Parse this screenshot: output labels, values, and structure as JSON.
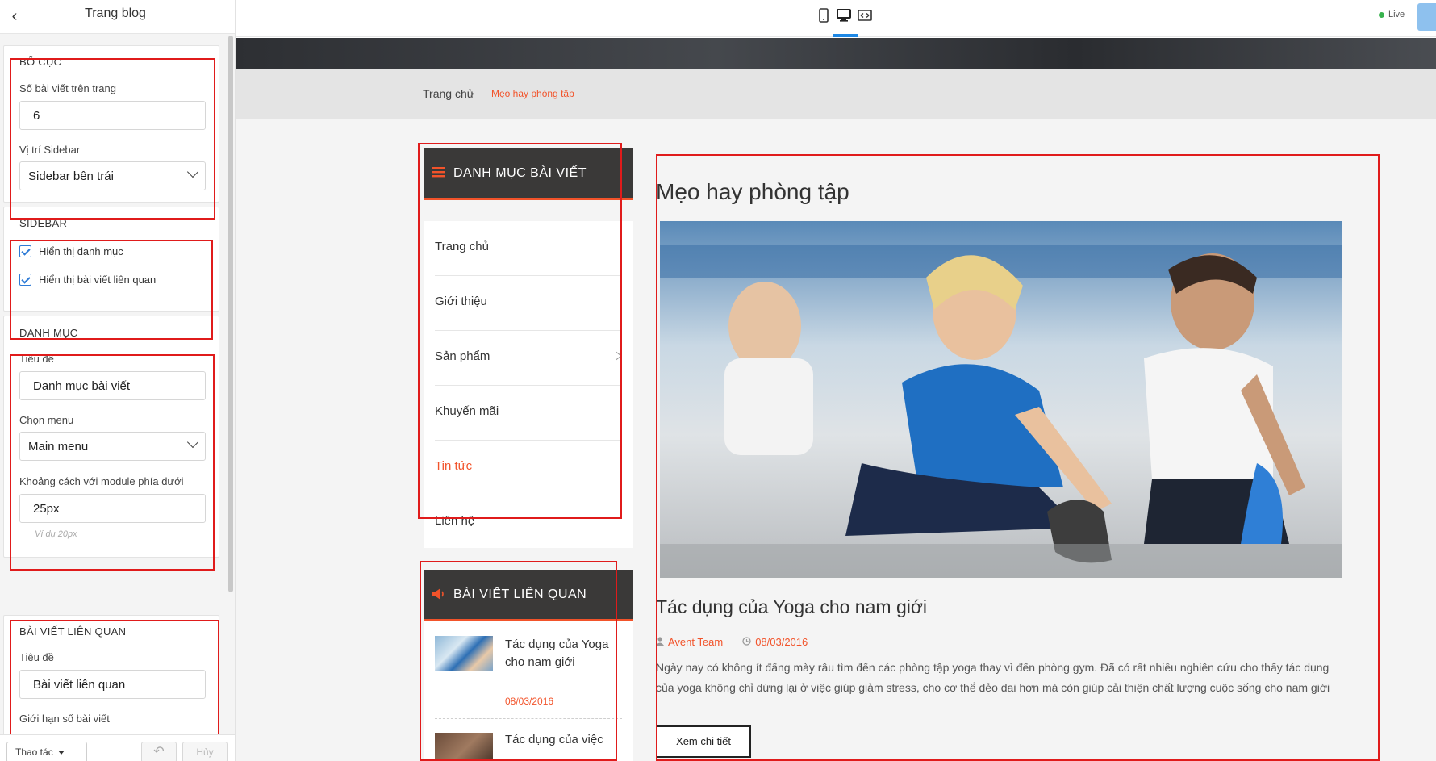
{
  "panel": {
    "title": "Trang blog",
    "layout": {
      "heading": "Bố cục",
      "posts_per_page_label": "Số bài viết trên trang",
      "posts_per_page_value": "6",
      "sidebar_position_label": "Vị trí Sidebar",
      "sidebar_position_value": "Sidebar bên trái"
    },
    "sidebar": {
      "heading": "SIDEBAR",
      "show_categories_label": "Hiển thị danh mục",
      "show_related_label": "Hiển thị bài viết liên quan"
    },
    "category": {
      "heading": "DANH MỤC",
      "title_label": "Tiêu đề",
      "title_value": "Danh mục bài viết",
      "menu_label": "Chọn menu",
      "menu_value": "Main menu",
      "spacing_label": "Khoảng cách với module phía dưới",
      "spacing_value": "25px",
      "spacing_hint": "Ví dụ 20px"
    },
    "related": {
      "heading": "BÀI VIẾT LIÊN QUAN",
      "title_label": "Tiêu đề",
      "title_value": "Bài viết liên quan",
      "limit_label": "Giới hạn số bài viết"
    },
    "footer": {
      "actions_label": "Thao tác",
      "undo_icon": "↶",
      "cancel_label": "Hủy"
    }
  },
  "topbar": {
    "live_label": "Live",
    "icons": [
      "mobile-icon",
      "desktop-icon",
      "wide-screen-icon"
    ]
  },
  "preview": {
    "breadcrumb": {
      "home": "Trang chủ",
      "separator": "›",
      "current": "Mẹo hay phòng tập"
    },
    "category_widget": {
      "title": "DANH MỤC BÀI VIẾT",
      "items": [
        "Trang chủ",
        "Giới thiệu",
        "Sản phẩm",
        "Khuyến mãi",
        "Tin tức",
        "Liên hệ"
      ],
      "active_item": "Tin tức"
    },
    "related_widget": {
      "title": "BÀI VIẾT LIÊN QUAN",
      "post_title": "Tác dụng của Yoga cho nam giới",
      "post_date": "08/03/2016",
      "next_post_title": "Tác dụng của việc"
    },
    "post": {
      "page_title": "Mẹo hay phòng tập",
      "title": "Tác dụng của Yoga cho nam giới",
      "author": "Avent Team",
      "date": "08/03/2016",
      "excerpt": "Ngày nay có không ít đấng mày râu tìm đến các phòng tập yoga thay vì đến phòng gym. Đã có rất nhiều nghiên cứu cho thấy tác dụng của yoga không chỉ dừng lại ở việc giúp giảm stress, cho cơ thể dẻo dai hơn mà còn giúp cải thiện chất lượng cuộc sống cho nam giới",
      "read_more": "Xem chi tiết"
    }
  },
  "colors": {
    "accent": "#f2532a",
    "highlight_box": "#e01b1b",
    "widget_head": "#3a3938"
  }
}
